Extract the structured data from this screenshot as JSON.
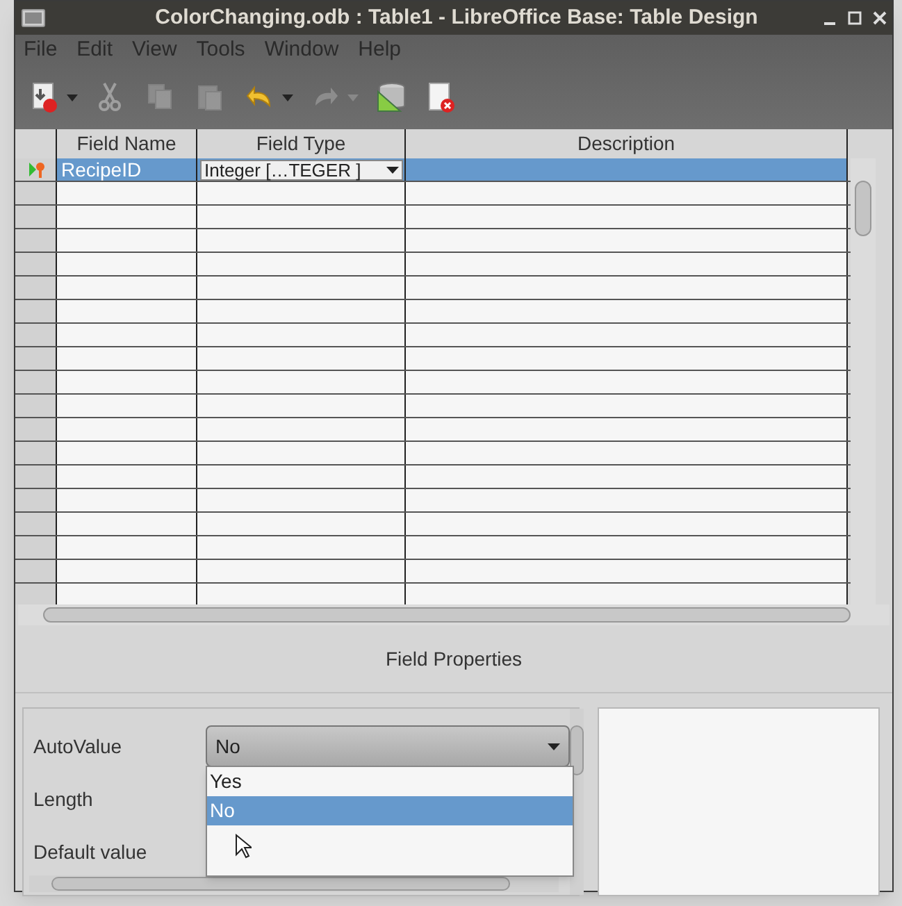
{
  "window": {
    "title": "ColorChanging.odb : Table1 - LibreOffice Base: Table Design"
  },
  "menu": [
    "File",
    "Edit",
    "View",
    "Tools",
    "Window",
    "Help"
  ],
  "toolbar": [
    {
      "kind": "save",
      "disabled": false,
      "caret": true
    },
    {
      "kind": "cut",
      "disabled": true,
      "caret": false
    },
    {
      "kind": "copy",
      "disabled": true,
      "caret": false
    },
    {
      "kind": "paste",
      "disabled": true,
      "caret": false
    },
    {
      "kind": "undo",
      "disabled": false,
      "caret": true
    },
    {
      "kind": "redo",
      "disabled": true,
      "caret": true
    },
    {
      "kind": "index",
      "disabled": false,
      "caret": false
    },
    {
      "kind": "close",
      "disabled": false,
      "caret": false
    }
  ],
  "table": {
    "columns": [
      "Field Name",
      "Field Type",
      "Description"
    ],
    "rows": [
      {
        "primary_key": true,
        "selected": true,
        "field_name": "RecipeID",
        "field_type": "Integer […TEGER ]"
      }
    ]
  },
  "field_properties": {
    "title": "Field Properties",
    "properties": [
      {
        "label": "AutoValue",
        "kind": "dropdown",
        "value": "No"
      },
      {
        "label": "Length",
        "kind": "text"
      },
      {
        "label": "Default value",
        "kind": "text"
      }
    ],
    "dropdown_options": [
      {
        "label": "Yes",
        "selected": false
      },
      {
        "label": "No",
        "selected": true
      }
    ]
  }
}
